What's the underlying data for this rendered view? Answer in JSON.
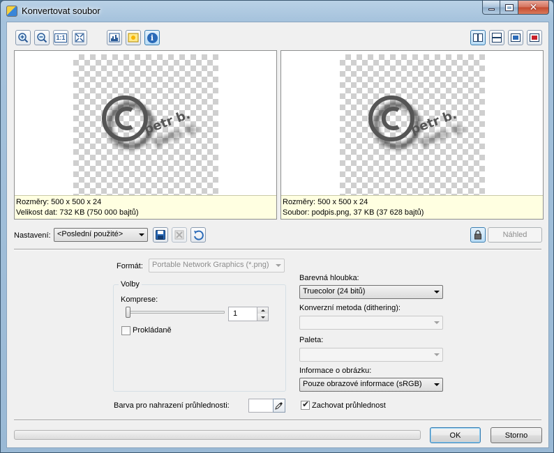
{
  "window": {
    "title": "Konvertovat soubor"
  },
  "toolbar": {
    "left_buttons": [
      {
        "icon": "zoom-in-icon"
      },
      {
        "icon": "zoom-out-icon"
      },
      {
        "label": "1:1",
        "icon": "actual-size-icon"
      },
      {
        "icon": "fit-to-window-icon"
      },
      {
        "icon": "histogram-icon"
      },
      {
        "icon": "image-adjust-icon"
      },
      {
        "label": "i",
        "icon": "info-icon"
      }
    ],
    "layout_buttons": [
      {
        "icon": "side-by-side-icon"
      },
      {
        "icon": "top-bottom-icon"
      },
      {
        "icon": "single-view-icon"
      },
      {
        "icon": "single-view-red-icon"
      }
    ]
  },
  "preview_left": {
    "watermark_text": "petr b.",
    "line1": "Rozměry: 500 x 500 x 24",
    "line2": "Velikost dat: 732 KB (750 000 bajtů)"
  },
  "preview_right": {
    "watermark_text": "petr b.",
    "line1": "Rozměry: 500 x 500 x 24",
    "line2": "Soubor: podpis.png, 37 KB (37 628 bajtů)"
  },
  "settings": {
    "label": "Nastavení:",
    "selected": "<Poslední použité>",
    "preview_button": "Náhled"
  },
  "format": {
    "label": "Formát:",
    "value": "Portable Network Graphics (*.png)"
  },
  "options": {
    "group_label": "Volby",
    "compression_label": "Komprese:",
    "compression_value": "1",
    "interlaced_label": "Prokládaně",
    "interlaced_checked": false
  },
  "right_column": {
    "color_depth_label": "Barevná hloubka:",
    "color_depth_value": "Truecolor (24 bitů)",
    "dithering_label": "Konverzní metoda (dithering):",
    "dithering_value": "",
    "palette_label": "Paleta:",
    "palette_value": "",
    "image_info_label": "Informace o obrázku:",
    "image_info_value": "Pouze obrazové informace (sRGB)",
    "keep_transparency_label": "Zachovat průhlednost",
    "keep_transparency_checked": true
  },
  "transparency": {
    "replace_color_label": "Barva pro nahrazení průhlednosti:"
  },
  "footer": {
    "ok_label": "OK",
    "cancel_label": "Storno",
    "progress": 0
  }
}
